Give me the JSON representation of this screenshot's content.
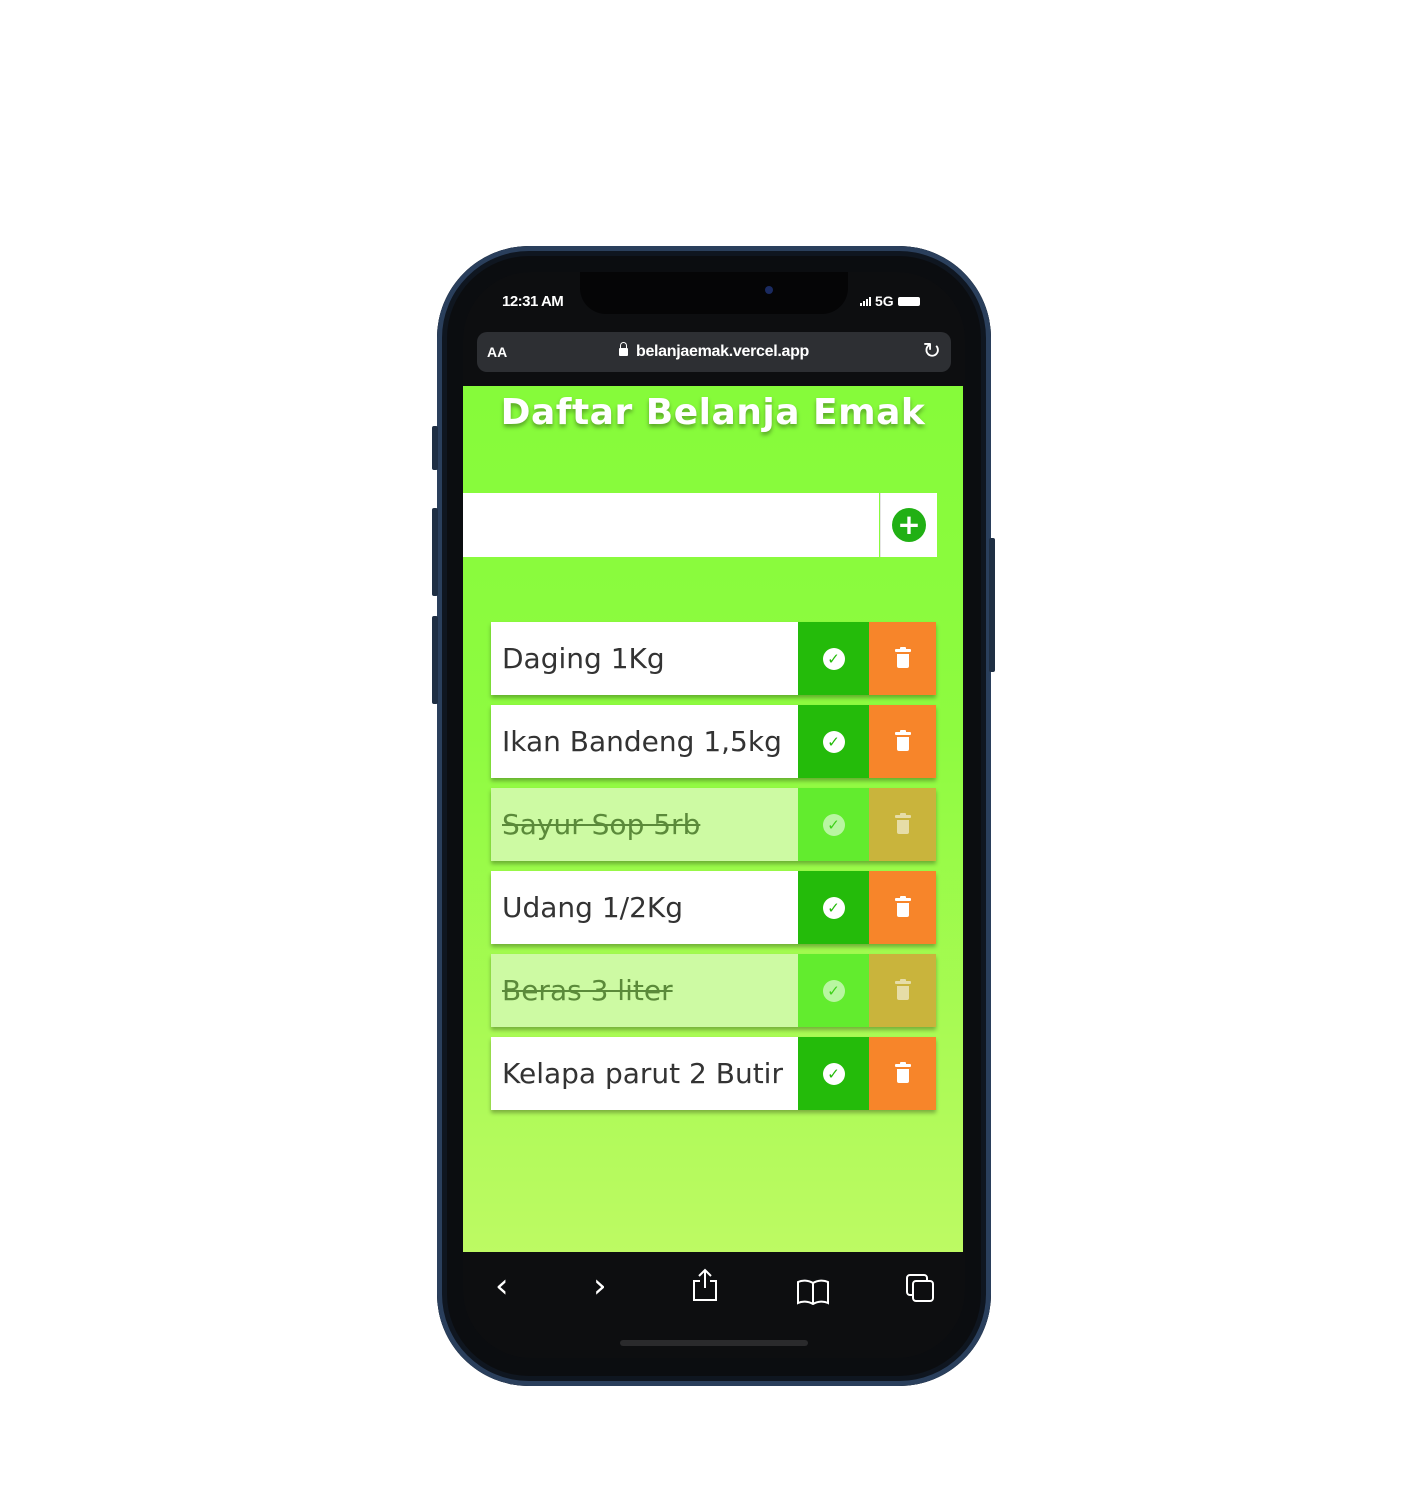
{
  "status_bar": {
    "time": "12:31 AM",
    "network": "5G"
  },
  "browser": {
    "text_size_label": "AA",
    "url": "belanjaemak.vercel.app",
    "reload_icon": "reload-icon"
  },
  "app": {
    "title": "Daftar Belanja Emak",
    "input": {
      "value": "",
      "placeholder": ""
    },
    "add_icon": "plus-circle-icon",
    "items": [
      {
        "label": "Daging 1Kg",
        "completed": false
      },
      {
        "label": "Ikan Bandeng 1,5kg",
        "completed": false
      },
      {
        "label": "Sayur Sop 5rb",
        "completed": true
      },
      {
        "label": "Udang 1/2Kg",
        "completed": false
      },
      {
        "label": "Beras 3 liter",
        "completed": true
      },
      {
        "label": "Kelapa parut 2 Butir",
        "completed": false
      }
    ]
  },
  "toolbar": {
    "icons": [
      "back-icon",
      "forward-icon",
      "share-icon",
      "bookmarks-icon",
      "tabs-icon"
    ]
  },
  "colors": {
    "background": "#86fb3a",
    "check": "#24bb0a",
    "trash": "#f7852a",
    "completed_row": "#cdfaa3"
  }
}
